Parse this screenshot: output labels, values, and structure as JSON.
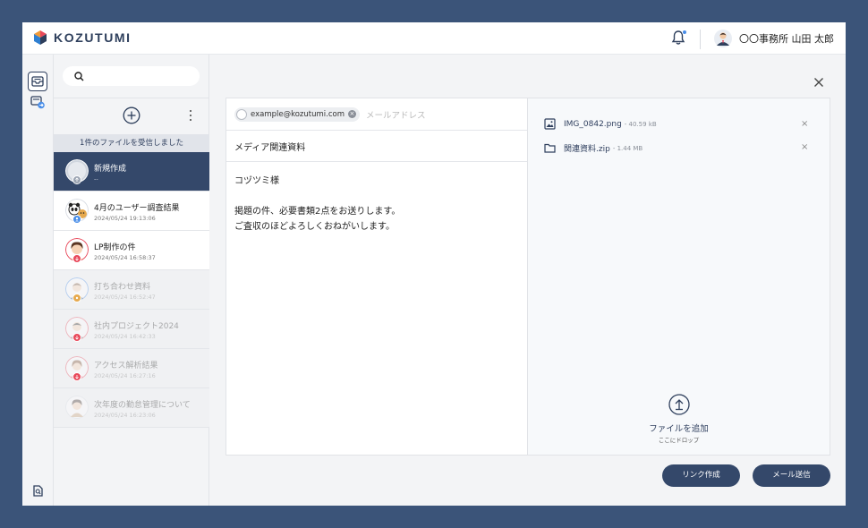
{
  "header": {
    "brand": "KOZUTUMI",
    "user_name": "〇〇事務所 山田 太郎",
    "colors": {
      "brand_navy": "#2e3f5c",
      "accent_blue": "#4a8ee8"
    }
  },
  "rail": {
    "items": [
      {
        "icon": "inbox-icon",
        "active": true
      },
      {
        "icon": "sent-box-icon",
        "active": false
      },
      {
        "icon": "file-search-icon",
        "active": false
      },
      {
        "icon": "help-icon",
        "active": false
      }
    ]
  },
  "list": {
    "search_placeholder": "",
    "received_banner": "1件のファイルを受信しました",
    "items": [
      {
        "title": "新規作成",
        "date": "--",
        "state": "selected"
      },
      {
        "title": "4月のユーザー調査結果",
        "date": "2024/05/24 19:13:06",
        "state": "normal"
      },
      {
        "title": "LP制作の件",
        "date": "2024/05/24 16:58:37",
        "state": "normal"
      },
      {
        "title": "打ち合わせ資料",
        "date": "2024/05/24 16:52:47",
        "state": "dim"
      },
      {
        "title": "社内プロジェクト2024",
        "date": "2024/05/24 16:42:33",
        "state": "dim"
      },
      {
        "title": "アクセス解析結果",
        "date": "2024/05/24 16:27:16",
        "state": "dim"
      },
      {
        "title": "次年度の勤怠管理について",
        "date": "2024/05/24 16:23:06",
        "state": "dim"
      }
    ]
  },
  "compose": {
    "recipient_chip": "example@kozutumi.com",
    "recipient_placeholder": "メールアドレス",
    "subject": "メディア関連資料",
    "body_lines": [
      "コヅツミ様",
      "",
      "掲題の件、必要書類2点をお送りします。",
      "ご査収のほどよろしくおねがいします。"
    ]
  },
  "attachments": {
    "files": [
      {
        "name": "IMG_0842.png",
        "size": "- 40.59 kB",
        "icon": "image-file-icon"
      },
      {
        "name": "関連資料.zip",
        "size": "- 1.44 MB",
        "icon": "folder-icon"
      }
    ],
    "upload_label": "ファイルを追加",
    "upload_sub": "ここにドロップ"
  },
  "actions": {
    "create_link": "リンク作成",
    "send_mail": "メール送信"
  }
}
